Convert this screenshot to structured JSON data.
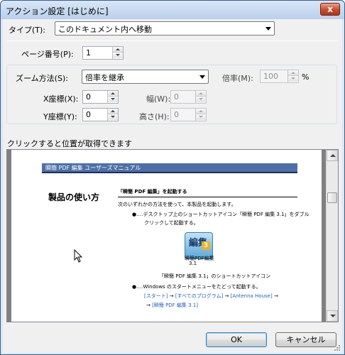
{
  "window": {
    "title": "アクション設定 [はじめに]",
    "close_glyph": "x"
  },
  "type_row": {
    "label": "タイプ(T):",
    "selected": "このドキュメント内へ移動"
  },
  "page_row": {
    "label": "ページ番号(P):",
    "value": "1"
  },
  "zoom": {
    "label": "ズーム方法(S):",
    "selected": "倍率を継承",
    "scale_label": "倍率(M):",
    "scale_value": "100",
    "scale_unit": "%"
  },
  "coords": {
    "x_label": "X座標(X):",
    "x_value": "0",
    "y_label": "Y座標(Y):",
    "y_value": "0",
    "w_label": "幅(W):",
    "w_value": "0",
    "h_label": "高さ(H):",
    "h_value": "0"
  },
  "preview": {
    "label": "クリックすると位置が取得できます",
    "doc_header": "瞬簡 PDF 編集  ユーザーズマニュアル",
    "doc_title": "製品の使い方",
    "section_title": "「瞬簡 PDF 編集」を起動する",
    "intro": "次のいずれかの方法を使って、本製品を起動します。",
    "bullet1_a": "●‥‥デスクトップ上のショートカットアイコン「瞬簡 PDF 編集 3.1」をダブル",
    "bullet1_b": "クリックして起動する。",
    "icon_big": "編集",
    "icon_num": "3",
    "icon_caption": "瞬簡PDF編集",
    "icon_version": "3.1",
    "icon_note": "「瞬簡 PDF 編集 3.1」のショートカットアイコン",
    "bullet2": "●‥‥Windows のスタートメニューをたどって起動する。",
    "path_start": "[スタート]",
    "path_arrow1": "→",
    "path_all": "[すべてのプログラム]",
    "path_arrow2": "→",
    "path_antenna": "[Antenna House]",
    "path_arrow3": "→",
    "path_app": "[瞬簡 PDF 編集 3.1]",
    "link_color": "#1f5fbf"
  },
  "buttons": {
    "ok": "OK",
    "cancel": "キャンセル"
  }
}
